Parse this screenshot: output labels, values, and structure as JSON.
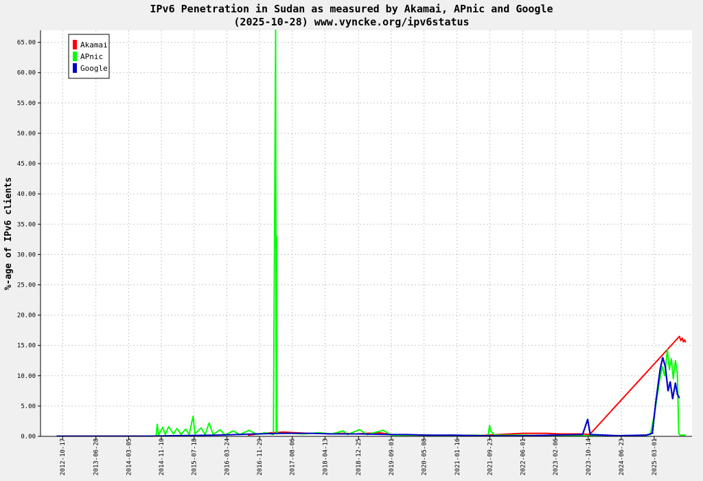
{
  "chart_data": {
    "type": "line",
    "title": "IPv6 Penetration in Sudan as measured by Akamai, APnic and Google",
    "subtitle": "(2025-10-28) www.vyncke.org/ipv6status",
    "ylabel": "%-age of IPv6 clients",
    "xlabel": "",
    "ylim": [
      0,
      67
    ],
    "yticks": [
      "0.00",
      "5.00",
      "10.00",
      "15.00",
      "20.00",
      "25.00",
      "30.00",
      "35.00",
      "40.00",
      "45.00",
      "50.00",
      "55.00",
      "60.00",
      "65.00"
    ],
    "xlim": [
      "2012-05-01",
      "2025-12-15"
    ],
    "xticks": [
      "2012-10-17",
      "2013-06-28",
      "2014-03-05",
      "2014-11-10",
      "2015-07-18",
      "2016-03-24",
      "2016-11-29",
      "2017-08-06",
      "2018-04-13",
      "2018-12-25",
      "2019-09-01",
      "2020-05-08",
      "2021-01-16",
      "2021-09-23",
      "2022-06-01",
      "2023-02-06",
      "2023-10-14",
      "2024-06-23",
      "2025-03-01"
    ],
    "grid": true,
    "legend_position": "top-left",
    "series": [
      {
        "name": "Akamai",
        "color": "#ff0000",
        "style": "solid",
        "points": [
          [
            "2016-09-01",
            0.2
          ],
          [
            "2016-12-01",
            0.4
          ],
          [
            "2017-03-01",
            0.6
          ],
          [
            "2017-06-01",
            0.7
          ],
          [
            "2017-09-01",
            0.6
          ],
          [
            "2017-12-01",
            0.5
          ],
          [
            "2018-03-01",
            0.5
          ],
          [
            "2018-06-01",
            0.4
          ],
          [
            "2018-09-01",
            0.5
          ],
          [
            "2018-12-01",
            0.4
          ],
          [
            "2019-03-01",
            0.5
          ],
          [
            "2019-06-01",
            0.6
          ],
          [
            "2019-09-01",
            0.3
          ],
          [
            "2019-12-01",
            0.2
          ],
          [
            "2020-03-01",
            0.2
          ],
          [
            "2020-06-01",
            0.2
          ],
          [
            "2020-09-01",
            0.1
          ],
          [
            "2020-12-01",
            0.2
          ],
          [
            "2021-03-01",
            0.1
          ],
          [
            "2021-06-01",
            0.1
          ],
          [
            "2021-09-01",
            0.2
          ],
          [
            "2021-12-01",
            0.3
          ],
          [
            "2022-03-01",
            0.4
          ],
          [
            "2022-06-01",
            0.5
          ],
          [
            "2022-09-01",
            0.5
          ],
          [
            "2022-12-01",
            0.5
          ],
          [
            "2023-03-01",
            0.4
          ],
          [
            "2023-06-01",
            0.4
          ],
          [
            "2023-09-01",
            0.4
          ],
          [
            "2023-10-25",
            0.3
          ],
          [
            "2025-09-10",
            16.5
          ],
          [
            "2025-09-20",
            15.8
          ],
          [
            "2025-10-01",
            16.2
          ],
          [
            "2025-10-10",
            15.6
          ],
          [
            "2025-10-20",
            15.9
          ],
          [
            "2025-10-28",
            15.5
          ]
        ]
      },
      {
        "name": "APnic",
        "color": "#00ff00",
        "style": "solid",
        "points": [
          [
            "2014-10-01",
            0.1
          ],
          [
            "2014-10-10",
            2.0
          ],
          [
            "2014-10-20",
            0.2
          ],
          [
            "2014-11-20",
            1.5
          ],
          [
            "2014-12-10",
            0.3
          ],
          [
            "2015-01-05",
            1.6
          ],
          [
            "2015-02-10",
            0.4
          ],
          [
            "2015-03-10",
            1.3
          ],
          [
            "2015-04-10",
            0.3
          ],
          [
            "2015-05-15",
            1.2
          ],
          [
            "2015-06-10",
            0.3
          ],
          [
            "2015-07-10",
            3.3
          ],
          [
            "2015-07-25",
            0.4
          ],
          [
            "2015-09-10",
            1.4
          ],
          [
            "2015-10-10",
            0.3
          ],
          [
            "2015-11-10",
            2.2
          ],
          [
            "2015-12-10",
            0.3
          ],
          [
            "2016-02-01",
            1.1
          ],
          [
            "2016-03-10",
            0.2
          ],
          [
            "2016-05-10",
            0.9
          ],
          [
            "2016-07-01",
            0.3
          ],
          [
            "2016-09-10",
            1.0
          ],
          [
            "2016-11-10",
            0.3
          ],
          [
            "2017-01-10",
            0.6
          ],
          [
            "2017-03-15",
            0.3
          ],
          [
            "2017-04-01",
            67.0
          ],
          [
            "2017-04-05",
            0.4
          ],
          [
            "2017-04-08",
            33.0
          ],
          [
            "2017-04-12",
            0.5
          ],
          [
            "2017-08-01",
            0.5
          ],
          [
            "2017-11-01",
            0.4
          ],
          [
            "2018-03-01",
            0.6
          ],
          [
            "2018-06-01",
            0.4
          ],
          [
            "2018-09-01",
            0.9
          ],
          [
            "2018-10-01",
            0.3
          ],
          [
            "2019-01-01",
            1.1
          ],
          [
            "2019-03-01",
            0.3
          ],
          [
            "2019-07-01",
            1.0
          ],
          [
            "2019-09-01",
            0.2
          ],
          [
            "2020-01-01",
            0.2
          ],
          [
            "2020-06-01",
            0.2
          ],
          [
            "2021-01-01",
            0.1
          ],
          [
            "2021-06-01",
            0.2
          ],
          [
            "2021-09-10",
            0.1
          ],
          [
            "2021-09-20",
            1.8
          ],
          [
            "2021-10-01",
            0.8
          ],
          [
            "2021-11-01",
            0.2
          ],
          [
            "2022-06-01",
            0.2
          ],
          [
            "2023-01-01",
            0.1
          ],
          [
            "2023-10-01",
            0.1
          ],
          [
            "2024-06-01",
            0.1
          ],
          [
            "2024-12-01",
            0.1
          ],
          [
            "2025-02-01",
            0.3
          ],
          [
            "2025-03-01",
            3.5
          ],
          [
            "2025-03-20",
            6.0
          ],
          [
            "2025-04-10",
            9.0
          ],
          [
            "2025-05-01",
            11.5
          ],
          [
            "2025-05-20",
            10.0
          ],
          [
            "2025-06-10",
            14.3
          ],
          [
            "2025-06-25",
            11.0
          ],
          [
            "2025-07-10",
            12.8
          ],
          [
            "2025-07-25",
            9.5
          ],
          [
            "2025-08-10",
            12.5
          ],
          [
            "2025-08-25",
            10.5
          ],
          [
            "2025-09-05",
            0.5
          ],
          [
            "2025-09-15",
            0.2
          ],
          [
            "2025-10-28",
            0.2
          ]
        ]
      },
      {
        "name": "Google",
        "color": "#0000cc",
        "style": "mixed",
        "points": [
          [
            "2012-09-01",
            0.05
          ],
          [
            "2014-09-01",
            0.05
          ],
          [
            "2015-01-01",
            0.1
          ],
          [
            "2016-01-01",
            0.2
          ],
          [
            "2016-11-01",
            0.4
          ],
          [
            "2017-06-01",
            0.5
          ],
          [
            "2018-01-01",
            0.5
          ],
          [
            "2018-06-01",
            0.4
          ],
          [
            "2019-01-01",
            0.4
          ],
          [
            "2019-09-01",
            0.3
          ],
          [
            "2020-01-01",
            0.3
          ],
          [
            "2020-06-01",
            0.2
          ],
          [
            "2021-01-01",
            0.2
          ],
          [
            "2021-09-01",
            0.1
          ],
          [
            "2022-06-01",
            0.1
          ],
          [
            "2023-01-01",
            0.2
          ],
          [
            "2023-09-01",
            0.3
          ],
          [
            "2023-10-10",
            2.8
          ],
          [
            "2023-10-30",
            0.3
          ],
          [
            "2024-06-01",
            0.1
          ],
          [
            "2025-01-01",
            0.2
          ],
          [
            "2025-02-15",
            0.5
          ],
          [
            "2025-03-15",
            6.0
          ],
          [
            "2025-04-15",
            11.0
          ],
          [
            "2025-05-05",
            13.0
          ],
          [
            "2025-05-25",
            11.5
          ],
          [
            "2025-06-15",
            7.5
          ],
          [
            "2025-07-01",
            9.0
          ],
          [
            "2025-07-20",
            6.2
          ],
          [
            "2025-08-10",
            8.8
          ],
          [
            "2025-08-25",
            7.0
          ],
          [
            "2025-09-10",
            6.3
          ]
        ]
      }
    ]
  }
}
